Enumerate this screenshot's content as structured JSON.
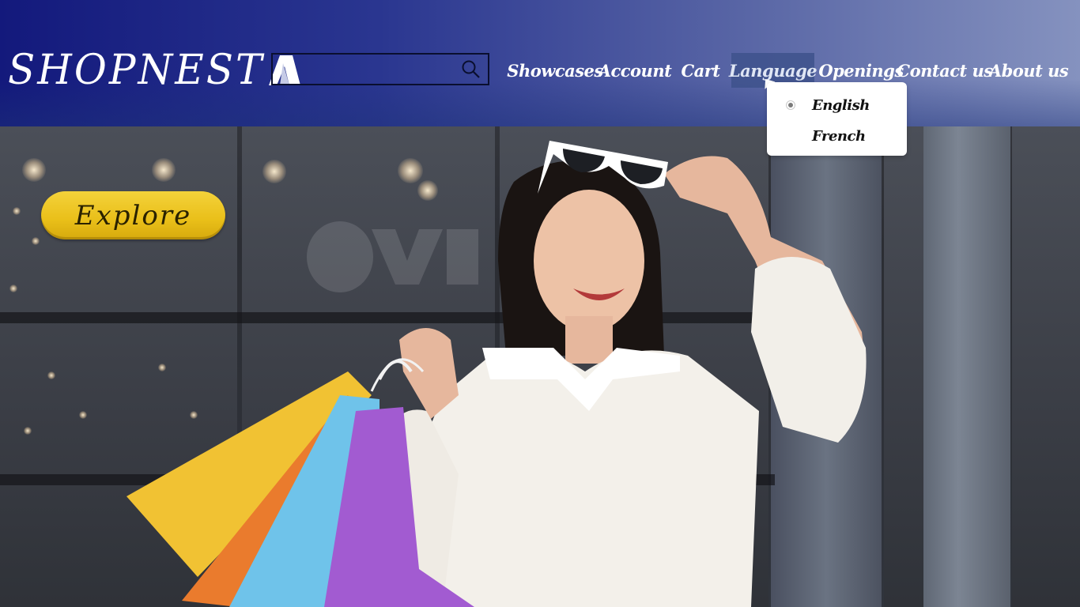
{
  "brand": {
    "logo_text": "SHOPNEST",
    "logo_mark_icon": "triangle-logo-icon"
  },
  "search": {
    "placeholder": "",
    "value": "",
    "icon": "search-icon"
  },
  "nav": {
    "items": [
      {
        "label": "Showcases"
      },
      {
        "label": "Account"
      },
      {
        "label": "Cart"
      },
      {
        "label": "Language"
      },
      {
        "label": "Openings"
      },
      {
        "label": "Contact us"
      },
      {
        "label": "About us"
      }
    ],
    "active": "Language"
  },
  "language_menu": {
    "options": [
      {
        "label": "English",
        "selected": true
      },
      {
        "label": "French",
        "selected": false
      }
    ]
  },
  "hero": {
    "cta_label": "Explore"
  },
  "colors": {
    "header_start": "#13197c",
    "header_end": "#8592bf",
    "cta_yellow": "#e9bf19",
    "menu_bg": "#ffffff"
  }
}
